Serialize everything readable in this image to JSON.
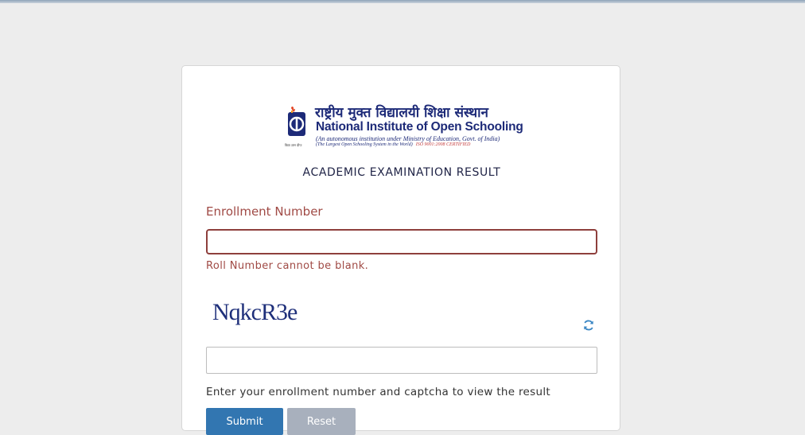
{
  "header": {
    "hindi_name": "राष्ट्रीय मुक्त विद्यालयी शिक्षा संस्थान",
    "english_name_prefix": "National Institute of ",
    "english_name_suffix": "Open Schooling",
    "subtitle1": "(An autonomous institution under Ministry of Education, Govt. of India)",
    "subtitle2": "(The Largest Open Schooling System in the World)",
    "iso": "ISO 9001:2008 CERTIFIED",
    "emblem_caption": "विद्या ज्ञान दीपः"
  },
  "page": {
    "title": "ACADEMIC EXAMINATION RESULT"
  },
  "form": {
    "enrollment_label": "Enrollment Number",
    "enrollment_value": "",
    "error": "Roll Number cannot be blank.",
    "captcha_text": "NqkcR3e",
    "captcha_value": "",
    "hint": "Enter your enrollment number and captcha to view the result",
    "submit_label": "Submit",
    "reset_label": "Reset"
  },
  "colors": {
    "brand": "#1d2a78",
    "error": "#a04a45",
    "primary": "#3276b1",
    "secondary": "#a8b0bd"
  },
  "icons": {
    "refresh": "refresh-icon",
    "emblem": "nios-emblem-icon"
  }
}
